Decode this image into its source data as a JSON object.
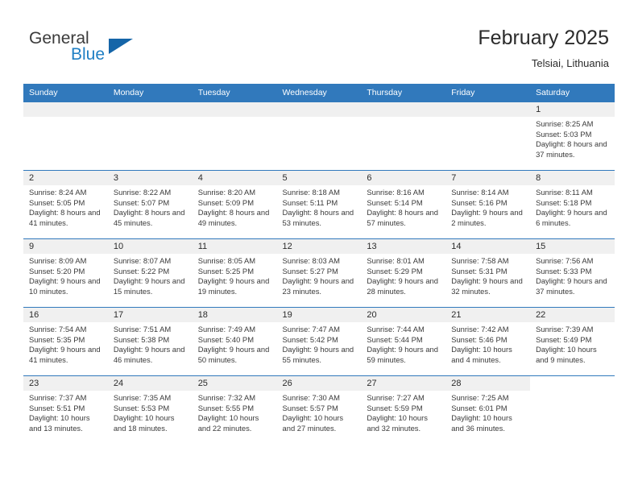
{
  "brand": {
    "word_one": "General",
    "word_two": "Blue",
    "triangle_icon": "brand-triangle-icon"
  },
  "header": {
    "title": "February 2025",
    "subtitle": "Telsiai, Lithuania"
  },
  "theme": {
    "header_blue": "#3179bc",
    "band_gray": "#f0f0f0",
    "brand_blue": "#1f7fc4",
    "text_dark": "#2b2b2b"
  },
  "weekdays": [
    "Sunday",
    "Monday",
    "Tuesday",
    "Wednesday",
    "Thursday",
    "Friday",
    "Saturday"
  ],
  "labels": {
    "sunrise": "Sunrise:",
    "sunset": "Sunset:",
    "daylight": "Daylight:"
  },
  "weeks": [
    [
      {
        "day": "",
        "sunrise": "",
        "sunset": "",
        "daylight": "",
        "empty": true,
        "shaded": true
      },
      {
        "day": "",
        "sunrise": "",
        "sunset": "",
        "daylight": "",
        "empty": true,
        "shaded": true
      },
      {
        "day": "",
        "sunrise": "",
        "sunset": "",
        "daylight": "",
        "empty": true,
        "shaded": true
      },
      {
        "day": "",
        "sunrise": "",
        "sunset": "",
        "daylight": "",
        "empty": true,
        "shaded": true
      },
      {
        "day": "",
        "sunrise": "",
        "sunset": "",
        "daylight": "",
        "empty": true,
        "shaded": true
      },
      {
        "day": "",
        "sunrise": "",
        "sunset": "",
        "daylight": "",
        "empty": true,
        "shaded": true
      },
      {
        "day": "1",
        "sunrise": "Sunrise: 8:25 AM",
        "sunset": "Sunset: 5:03 PM",
        "daylight": "Daylight: 8 hours and 37 minutes.",
        "empty": false,
        "shaded": true
      }
    ],
    [
      {
        "day": "2",
        "sunrise": "Sunrise: 8:24 AM",
        "sunset": "Sunset: 5:05 PM",
        "daylight": "Daylight: 8 hours and 41 minutes.",
        "empty": false,
        "shaded": true
      },
      {
        "day": "3",
        "sunrise": "Sunrise: 8:22 AM",
        "sunset": "Sunset: 5:07 PM",
        "daylight": "Daylight: 8 hours and 45 minutes.",
        "empty": false,
        "shaded": true
      },
      {
        "day": "4",
        "sunrise": "Sunrise: 8:20 AM",
        "sunset": "Sunset: 5:09 PM",
        "daylight": "Daylight: 8 hours and 49 minutes.",
        "empty": false,
        "shaded": true
      },
      {
        "day": "5",
        "sunrise": "Sunrise: 8:18 AM",
        "sunset": "Sunset: 5:11 PM",
        "daylight": "Daylight: 8 hours and 53 minutes.",
        "empty": false,
        "shaded": true
      },
      {
        "day": "6",
        "sunrise": "Sunrise: 8:16 AM",
        "sunset": "Sunset: 5:14 PM",
        "daylight": "Daylight: 8 hours and 57 minutes.",
        "empty": false,
        "shaded": true
      },
      {
        "day": "7",
        "sunrise": "Sunrise: 8:14 AM",
        "sunset": "Sunset: 5:16 PM",
        "daylight": "Daylight: 9 hours and 2 minutes.",
        "empty": false,
        "shaded": true
      },
      {
        "day": "8",
        "sunrise": "Sunrise: 8:11 AM",
        "sunset": "Sunset: 5:18 PM",
        "daylight": "Daylight: 9 hours and 6 minutes.",
        "empty": false,
        "shaded": true
      }
    ],
    [
      {
        "day": "9",
        "sunrise": "Sunrise: 8:09 AM",
        "sunset": "Sunset: 5:20 PM",
        "daylight": "Daylight: 9 hours and 10 minutes.",
        "empty": false,
        "shaded": true
      },
      {
        "day": "10",
        "sunrise": "Sunrise: 8:07 AM",
        "sunset": "Sunset: 5:22 PM",
        "daylight": "Daylight: 9 hours and 15 minutes.",
        "empty": false,
        "shaded": true
      },
      {
        "day": "11",
        "sunrise": "Sunrise: 8:05 AM",
        "sunset": "Sunset: 5:25 PM",
        "daylight": "Daylight: 9 hours and 19 minutes.",
        "empty": false,
        "shaded": true
      },
      {
        "day": "12",
        "sunrise": "Sunrise: 8:03 AM",
        "sunset": "Sunset: 5:27 PM",
        "daylight": "Daylight: 9 hours and 23 minutes.",
        "empty": false,
        "shaded": true
      },
      {
        "day": "13",
        "sunrise": "Sunrise: 8:01 AM",
        "sunset": "Sunset: 5:29 PM",
        "daylight": "Daylight: 9 hours and 28 minutes.",
        "empty": false,
        "shaded": true
      },
      {
        "day": "14",
        "sunrise": "Sunrise: 7:58 AM",
        "sunset": "Sunset: 5:31 PM",
        "daylight": "Daylight: 9 hours and 32 minutes.",
        "empty": false,
        "shaded": true
      },
      {
        "day": "15",
        "sunrise": "Sunrise: 7:56 AM",
        "sunset": "Sunset: 5:33 PM",
        "daylight": "Daylight: 9 hours and 37 minutes.",
        "empty": false,
        "shaded": true
      }
    ],
    [
      {
        "day": "16",
        "sunrise": "Sunrise: 7:54 AM",
        "sunset": "Sunset: 5:35 PM",
        "daylight": "Daylight: 9 hours and 41 minutes.",
        "empty": false,
        "shaded": true
      },
      {
        "day": "17",
        "sunrise": "Sunrise: 7:51 AM",
        "sunset": "Sunset: 5:38 PM",
        "daylight": "Daylight: 9 hours and 46 minutes.",
        "empty": false,
        "shaded": true
      },
      {
        "day": "18",
        "sunrise": "Sunrise: 7:49 AM",
        "sunset": "Sunset: 5:40 PM",
        "daylight": "Daylight: 9 hours and 50 minutes.",
        "empty": false,
        "shaded": true
      },
      {
        "day": "19",
        "sunrise": "Sunrise: 7:47 AM",
        "sunset": "Sunset: 5:42 PM",
        "daylight": "Daylight: 9 hours and 55 minutes.",
        "empty": false,
        "shaded": true
      },
      {
        "day": "20",
        "sunrise": "Sunrise: 7:44 AM",
        "sunset": "Sunset: 5:44 PM",
        "daylight": "Daylight: 9 hours and 59 minutes.",
        "empty": false,
        "shaded": true
      },
      {
        "day": "21",
        "sunrise": "Sunrise: 7:42 AM",
        "sunset": "Sunset: 5:46 PM",
        "daylight": "Daylight: 10 hours and 4 minutes.",
        "empty": false,
        "shaded": true
      },
      {
        "day": "22",
        "sunrise": "Sunrise: 7:39 AM",
        "sunset": "Sunset: 5:49 PM",
        "daylight": "Daylight: 10 hours and 9 minutes.",
        "empty": false,
        "shaded": true
      }
    ],
    [
      {
        "day": "23",
        "sunrise": "Sunrise: 7:37 AM",
        "sunset": "Sunset: 5:51 PM",
        "daylight": "Daylight: 10 hours and 13 minutes.",
        "empty": false,
        "shaded": true
      },
      {
        "day": "24",
        "sunrise": "Sunrise: 7:35 AM",
        "sunset": "Sunset: 5:53 PM",
        "daylight": "Daylight: 10 hours and 18 minutes.",
        "empty": false,
        "shaded": true
      },
      {
        "day": "25",
        "sunrise": "Sunrise: 7:32 AM",
        "sunset": "Sunset: 5:55 PM",
        "daylight": "Daylight: 10 hours and 22 minutes.",
        "empty": false,
        "shaded": true
      },
      {
        "day": "26",
        "sunrise": "Sunrise: 7:30 AM",
        "sunset": "Sunset: 5:57 PM",
        "daylight": "Daylight: 10 hours and 27 minutes.",
        "empty": false,
        "shaded": true
      },
      {
        "day": "27",
        "sunrise": "Sunrise: 7:27 AM",
        "sunset": "Sunset: 5:59 PM",
        "daylight": "Daylight: 10 hours and 32 minutes.",
        "empty": false,
        "shaded": true
      },
      {
        "day": "28",
        "sunrise": "Sunrise: 7:25 AM",
        "sunset": "Sunset: 6:01 PM",
        "daylight": "Daylight: 10 hours and 36 minutes.",
        "empty": false,
        "shaded": true
      },
      {
        "day": "",
        "sunrise": "",
        "sunset": "",
        "daylight": "",
        "empty": true,
        "shaded": false
      }
    ]
  ]
}
